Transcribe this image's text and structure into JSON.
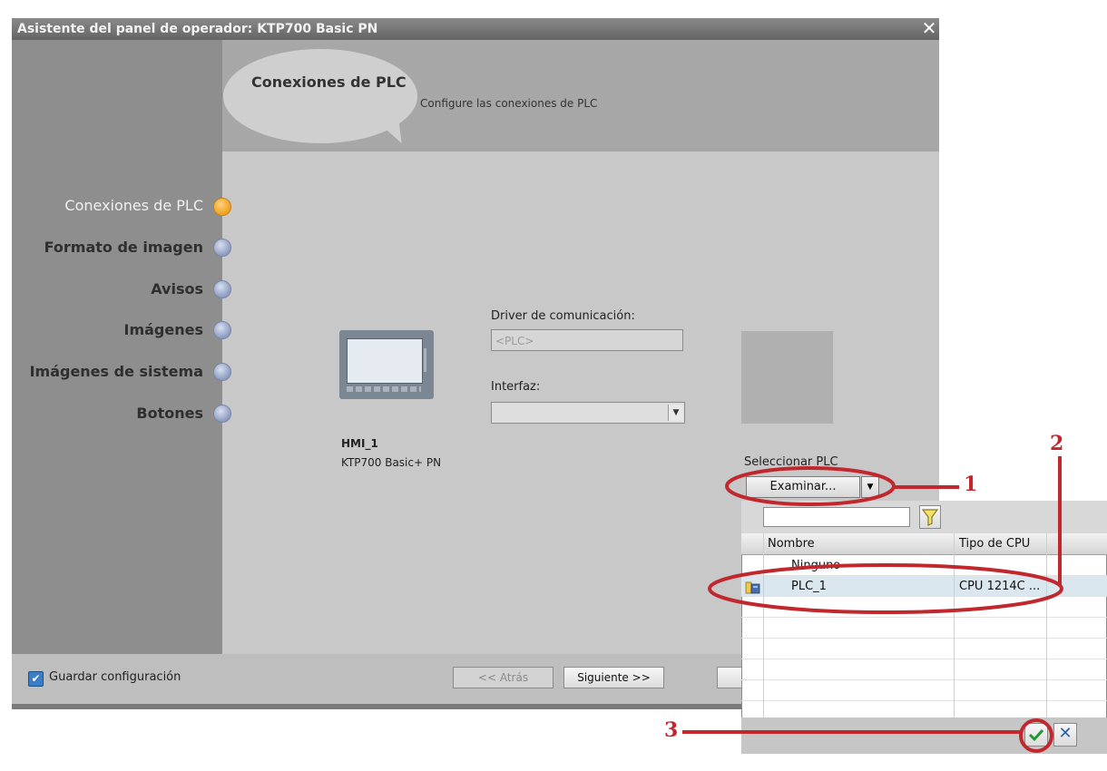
{
  "window": {
    "title": "Asistente del panel de operador: KTP700 Basic PN",
    "close_glyph": "✕"
  },
  "header": {
    "title": "Conexiones de PLC",
    "subtitle": "Configure las conexiones de PLC"
  },
  "steps": [
    {
      "label": "Conexiones de PLC",
      "state": "active"
    },
    {
      "label": "Formato de imagen",
      "state": "pending"
    },
    {
      "label": "Avisos",
      "state": "pending"
    },
    {
      "label": "Imágenes",
      "state": "pending"
    },
    {
      "label": "Imágenes de sistema",
      "state": "pending"
    },
    {
      "label": "Botones",
      "state": "pending"
    }
  ],
  "hmi": {
    "name": "HMI_1",
    "model": "KTP700 Basic+ PN"
  },
  "driver": {
    "label": "Driver de comunicación:",
    "value": "<PLC>"
  },
  "interfaz": {
    "label": "Interfaz:",
    "value": ""
  },
  "select_plc": {
    "label": "Seleccionar PLC",
    "button": "Examinar..."
  },
  "footer": {
    "save_config_label": "Guardar configuración",
    "save_config_checked": true,
    "back_button": "<< Atrás",
    "next_button": "Siguiente >>"
  },
  "plc_list": {
    "search_value": "",
    "columns": [
      "Nombre",
      "Tipo de CPU"
    ],
    "rows": [
      {
        "name": "Ninguno",
        "cpu": ""
      },
      {
        "name": "PLC_1",
        "cpu": "CPU 1214C ..."
      }
    ]
  },
  "annotations": {
    "one": "1",
    "two": "2",
    "three": "3"
  },
  "colors": {
    "annotation_red": "#c0282d",
    "active_step": "#f0a020",
    "pending_step": "#8c9bc0",
    "checkbox_blue": "#3b7ec8"
  },
  "icons": [
    "close-icon",
    "dropdown-arrow-icon",
    "filter-icon",
    "plc-icon",
    "ok-check-icon",
    "cancel-x-icon",
    "checkbox-checked-icon"
  ]
}
